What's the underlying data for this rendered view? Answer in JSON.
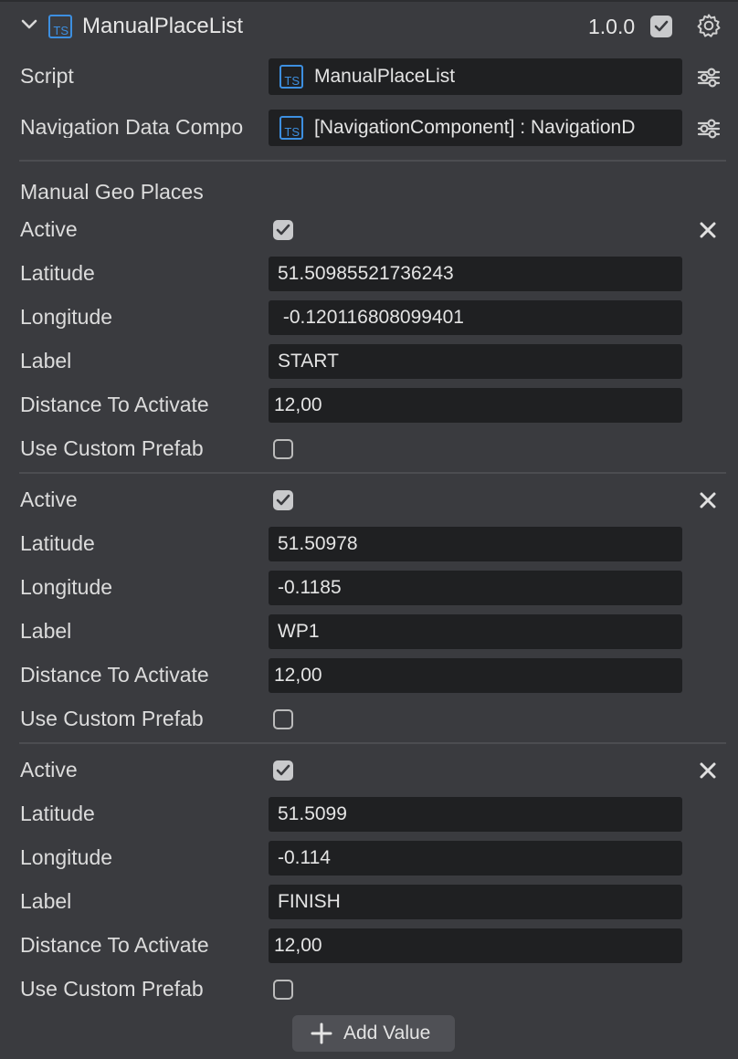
{
  "component": {
    "name": "ManualPlaceList",
    "version": "1.0.0"
  },
  "script": {
    "label": "Script",
    "value": "ManualPlaceList"
  },
  "navigation": {
    "label": "Navigation Data Compo",
    "value": "[NavigationComponent] : NavigationD"
  },
  "list": {
    "title": "Manual Geo Places",
    "add_label": "Add Value"
  },
  "field_labels": {
    "active": "Active",
    "latitude": "Latitude",
    "longitude": "Longitude",
    "label": "Label",
    "distance": "Distance To Activate",
    "custom_prefab": "Use Custom Prefab"
  },
  "places": [
    {
      "active": true,
      "latitude": "51.50985521736243",
      "longitude": " -0.120116808099401",
      "label": "START",
      "distance": "12,00",
      "use_custom_prefab": false
    },
    {
      "active": true,
      "latitude": "51.50978",
      "longitude": "-0.1185",
      "label": "WP1",
      "distance": "12,00",
      "use_custom_prefab": false
    },
    {
      "active": true,
      "latitude": "51.5099",
      "longitude": "-0.114",
      "label": "FINISH",
      "distance": "12,00",
      "use_custom_prefab": false
    }
  ],
  "colors": {
    "background": "#3a3b3f",
    "field": "#1f2022",
    "accent": "#3d8fe0",
    "checkbox": "#c9cacc"
  }
}
